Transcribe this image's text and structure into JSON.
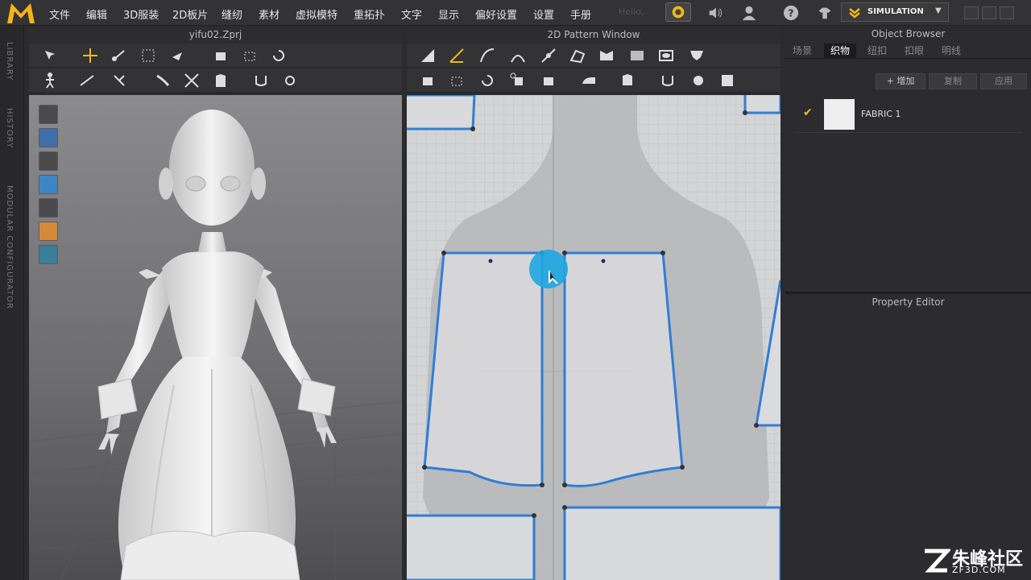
{
  "app": {
    "logo_text": "M"
  },
  "menubar": {
    "items": [
      "文件",
      "编辑",
      "3D服装",
      "2D板片",
      "缝纫",
      "素材",
      "虚拟模特",
      "重拓扑",
      "文字",
      "显示",
      "偏好设置",
      "设置",
      "手册"
    ],
    "hello": "Hello,",
    "simulation_label": "SIMULATION"
  },
  "left_strip": {
    "tabs": [
      "LIBRARY",
      "HISTORY",
      "MODULAR CONFIGURATOR"
    ]
  },
  "panel3d": {
    "title": "yifu02.Zprj"
  },
  "panel2d": {
    "title": "2D Pattern Window"
  },
  "object_browser": {
    "title": "Object Browser",
    "tabs": [
      "场景",
      "织物",
      "纽扣",
      "扣眼",
      "明线"
    ],
    "active_tab": "织物",
    "add_label": "+ 增加",
    "copy_label": "复制",
    "apply_label": "应用",
    "fabrics": [
      {
        "name": "FABRIC 1",
        "color": "#eeeeee"
      }
    ]
  },
  "property_editor": {
    "title": "Property Editor"
  },
  "watermark": {
    "title": "朱峰社区",
    "subtitle": "ZF3D.COM"
  },
  "colors": {
    "accent": "#f2b81b",
    "pattern_outline": "#2f7fd4",
    "highlight": "#1ea7e0"
  }
}
